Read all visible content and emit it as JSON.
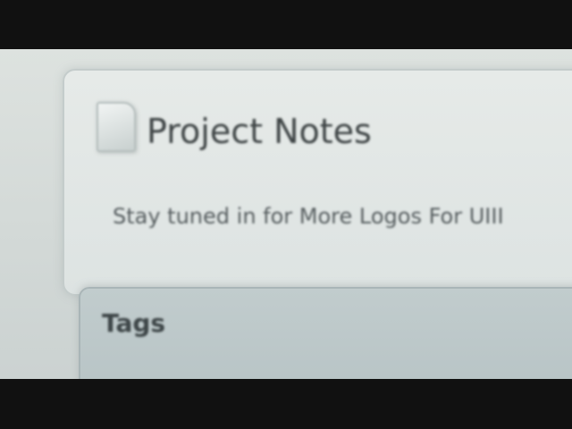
{
  "project_notes": {
    "title": "Project Notes",
    "icon": "document-icon",
    "body": "Stay tuned in for More Logos For UIII"
  },
  "tags": {
    "title": "Tags"
  }
}
